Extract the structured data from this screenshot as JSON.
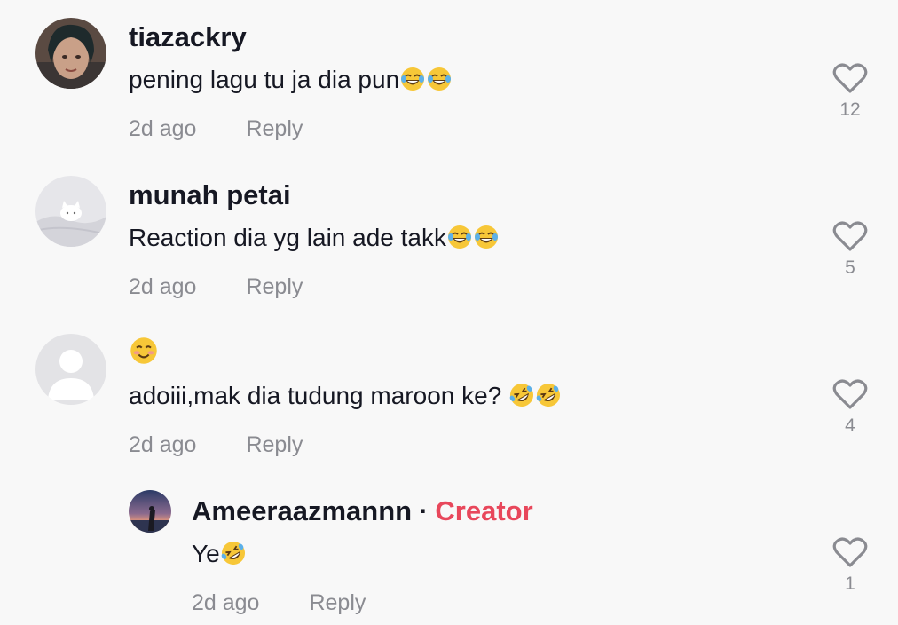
{
  "comments": [
    {
      "username": "tiazackry",
      "text": "pening lagu tu ja dia pun",
      "text_emojis": [
        "face-with-tears-of-joy-emoji",
        "face-with-tears-of-joy-emoji"
      ],
      "time": "2d ago",
      "reply": "Reply",
      "likes": "12",
      "avatar": "woman-avatar"
    },
    {
      "username": "munah petai",
      "text": "Reaction dia yg lain ade takk",
      "text_emojis": [
        "face-with-tears-of-joy-emoji",
        "face-with-tears-of-joy-emoji"
      ],
      "time": "2d ago",
      "reply": "Reply",
      "likes": "5",
      "avatar": "cat-avatar"
    },
    {
      "username_emoji": "smiling-face-emoji",
      "text": "adoiii,mak dia tudung maroon ke? ",
      "text_emojis": [
        "rolling-on-floor-laughing-emoji",
        "rolling-on-floor-laughing-emoji"
      ],
      "time": "2d ago",
      "reply": "Reply",
      "likes": "4",
      "avatar": "default-avatar"
    }
  ],
  "reply_comment": {
    "username": "Ameeraazmannn",
    "separator": "·",
    "badge": "Creator",
    "text": "Ye",
    "text_emojis": [
      "rolling-on-floor-laughing-emoji"
    ],
    "time": "2d ago",
    "reply": "Reply",
    "likes": "1",
    "avatar": "sunset-avatar"
  },
  "colors": {
    "background": "#f8f8f8",
    "creator_badge": "#e8475b",
    "meta_text": "#8a8b91"
  }
}
